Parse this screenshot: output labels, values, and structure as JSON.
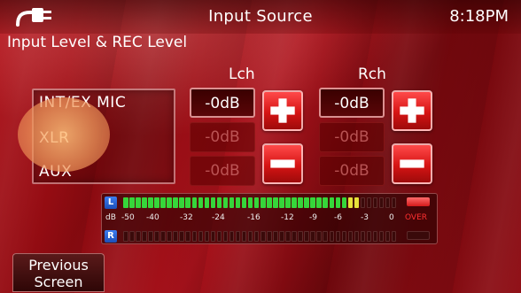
{
  "header": {
    "title": "Input Source",
    "clock": "8:18PM",
    "left_icon": "plug-icon"
  },
  "subtitle": "Input Level & REC Level",
  "channels": {
    "left_label": "Lch",
    "right_label": "Rch"
  },
  "sources": [
    {
      "label": "INT/EX MIC",
      "selected": true
    },
    {
      "label": "XLR",
      "selected": false
    },
    {
      "label": "AUX",
      "selected": false
    }
  ],
  "levels": {
    "lch": [
      "-0dB",
      "-0dB",
      "-0dB"
    ],
    "rch": [
      "-0dB",
      "-0dB",
      "-0dB"
    ]
  },
  "buttons": {
    "plus_icon": "plus-icon",
    "minus_icon": "minus-icon"
  },
  "meter": {
    "left_channel_tag": "L",
    "right_channel_tag": "R",
    "scale": [
      "dB",
      "-50",
      "-40",
      "-32",
      "-24",
      "-16",
      "-12",
      "-9",
      "-6",
      "-3",
      "0"
    ],
    "over_label": "OVER",
    "left_level_segments_lit": 38,
    "right_level_segments_lit": 0,
    "colors": {
      "green": "#36d63a",
      "yellow": "#e6e23a",
      "red": "#ff3a3a",
      "off": "#3a0a0a"
    }
  },
  "footer": {
    "previous_label_line1": "Previous",
    "previous_label_line2": "Screen"
  }
}
